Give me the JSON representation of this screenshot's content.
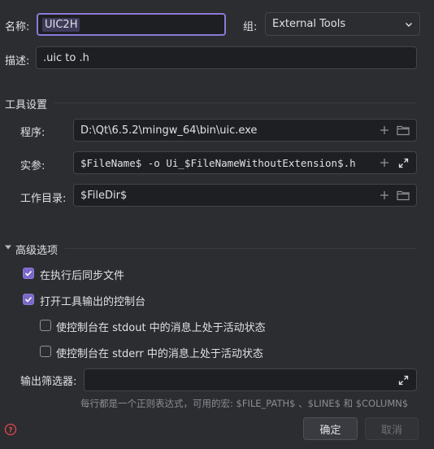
{
  "general": {
    "name_label": "名称:",
    "name_value": "UIC2H",
    "group_label": "组:",
    "group_value": "External Tools",
    "desc_label": "描述:",
    "desc_value": ".uic to .h"
  },
  "tool_settings": {
    "title": "工具设置",
    "program_label": "程序:",
    "program_value": "D:\\Qt\\6.5.2\\mingw_64\\bin\\uic.exe",
    "args_label": "实参:",
    "args_value": "$FileName$ -o Ui_$FileNameWithoutExtension$.h",
    "workdir_label": "工作目录:",
    "workdir_value": "$FileDir$"
  },
  "advanced": {
    "title": "高级选项",
    "options": [
      {
        "label": "在执行后同步文件",
        "checked": true
      },
      {
        "label": "打开工具输出的控制台",
        "checked": true
      },
      {
        "label": "使控制台在 stdout 中的消息上处于活动状态",
        "checked": false
      },
      {
        "label": "使控制台在 stderr 中的消息上处于活动状态",
        "checked": false
      }
    ],
    "filter_label": "输出筛选器:",
    "filter_value": "",
    "hint": "每行都是一个正则表达式，可用的宏: $FILE_PATH$ 、$LINE$ 和 $COLUMN$"
  },
  "footer": {
    "ok_label": "确定",
    "cancel_label": "取消"
  },
  "colors": {
    "accent": "#8c79d8",
    "background": "#2b2d30",
    "field": "#1e1f22",
    "help": "#e0474d"
  },
  "icons": {
    "add": "plus-icon",
    "browse": "folder-icon",
    "expand": "expand-icon",
    "collapse": "triangle-down-icon",
    "help": "help-icon"
  }
}
